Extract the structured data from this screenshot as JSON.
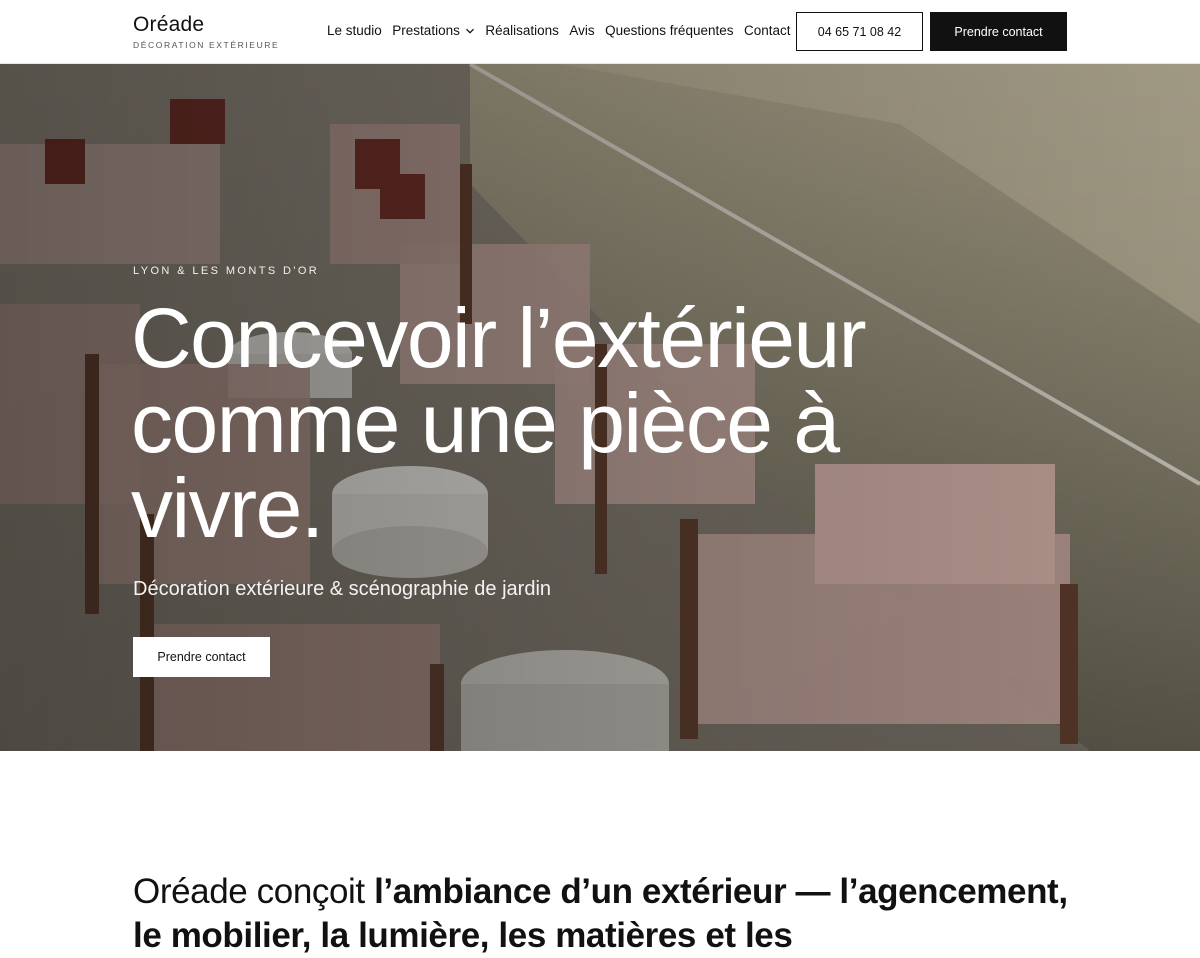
{
  "brand": {
    "name": "Oréade",
    "tagline": "DÉCORATION EXTÉRIEURE"
  },
  "nav": {
    "items": [
      {
        "label": "Le studio"
      },
      {
        "label": "Prestations",
        "icon": "chevron-down-icon"
      },
      {
        "label": "Réalisations"
      },
      {
        "label": "Avis"
      },
      {
        "label": "Questions fréquentes"
      },
      {
        "label": "Contact"
      }
    ],
    "phone_label": "04 65 71 08 42",
    "cta_label": "Prendre contact"
  },
  "hero": {
    "eyebrow": "LYON & LES MONTS D'OR",
    "title": "Concevoir l’extérieur comme une pièce à vivre.",
    "subtitle": "Décoration extérieure & scénographie de jardin",
    "cta_label": "Prendre contact"
  },
  "intro": {
    "lead": "Oréade conçoit ",
    "emphasis": "l’ambiance d’un extérieur — l’agencement, le mobilier, la lumière, les matières et les"
  },
  "colors": {
    "primary": "#111111",
    "background": "#ffffff",
    "hero_text": "#ffffff"
  }
}
